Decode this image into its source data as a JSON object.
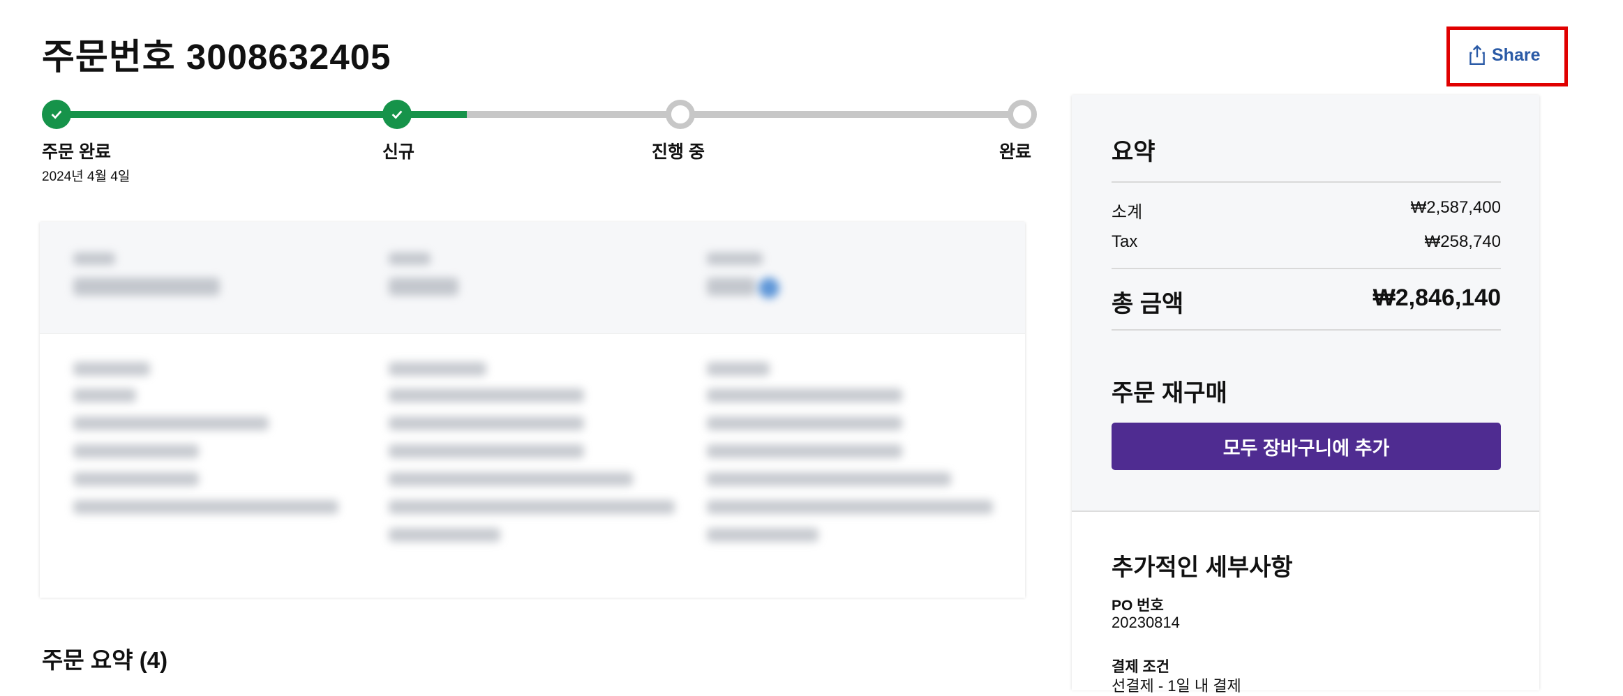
{
  "order": {
    "title": "주문번호 3008632405"
  },
  "share": {
    "label": "Share"
  },
  "progress": {
    "steps": [
      {
        "label": "주문 완료",
        "date": "2024년 4월 4일",
        "status": "done"
      },
      {
        "label": "신규",
        "status": "done"
      },
      {
        "label": "진행 중",
        "status": "pending"
      },
      {
        "label": "완료",
        "status": "pending"
      }
    ],
    "fraction_complete": 0.43
  },
  "order_summary": {
    "title": "주문 요약 (4)"
  },
  "summary": {
    "title": "요약",
    "subtotal_label": "소계",
    "subtotal_value": "₩2,587,400",
    "tax_label": "Tax",
    "tax_value": "₩258,740",
    "total_label": "총 금액",
    "total_value": "₩2,846,140"
  },
  "reorder": {
    "title": "주문 재구매",
    "button_label": "모두 장바구니에 추가"
  },
  "extra": {
    "title": "추가적인 세부사항",
    "po_label": "PO 번호",
    "po_value": "20230814",
    "payment_label": "결제 조건",
    "payment_value": "선결제 - 1일 내 결제"
  },
  "colors": {
    "progress": "#16934a",
    "track": "#c7c7c7",
    "button": "#4f2c91",
    "share_text": "#2a5aa6",
    "highlight": "#e00000"
  }
}
